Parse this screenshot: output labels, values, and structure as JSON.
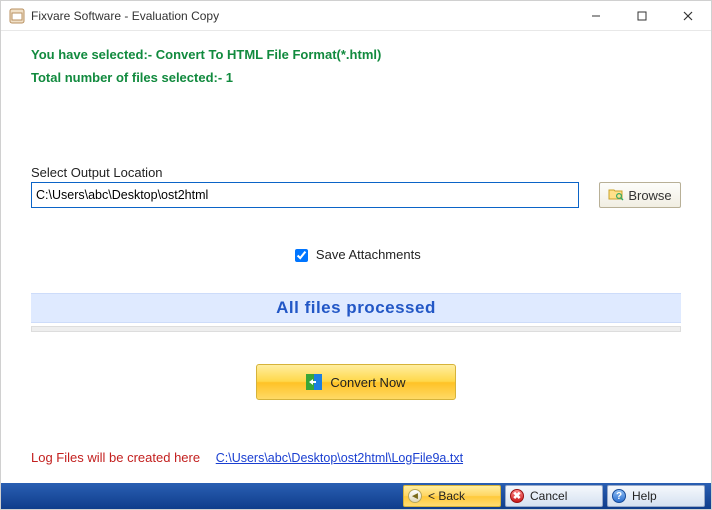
{
  "window": {
    "title": "Fixvare Software - Evaluation Copy"
  },
  "info": {
    "selection_text": "You have selected:- Convert To HTML File Format(*.html)",
    "count_text": "Total number of files selected:- 1"
  },
  "output": {
    "label": "Select Output Location",
    "path": "C:\\Users\\abc\\Desktop\\ost2html",
    "browse_label": "Browse"
  },
  "options": {
    "save_attachments_label": "Save Attachments",
    "save_attachments_checked": true
  },
  "status": {
    "text": "All files processed"
  },
  "actions": {
    "convert_label": "Convert Now"
  },
  "log": {
    "label": "Log Files will be created here",
    "link": "C:\\Users\\abc\\Desktop\\ost2html\\LogFile9a.txt"
  },
  "footer": {
    "back": "< Back",
    "cancel": "Cancel",
    "help": "Help"
  }
}
